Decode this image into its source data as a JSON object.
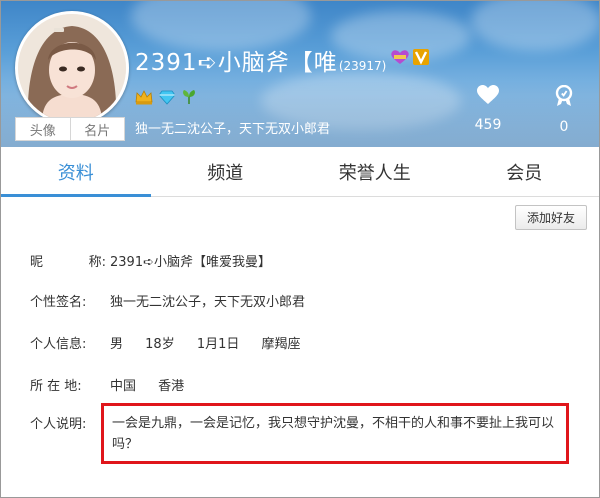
{
  "profile": {
    "nickname": "2391➪小脑斧【唯",
    "user_number": "(23917)",
    "signature": "独一无二沈公子，天下无双小郎君",
    "avatar_tabs": [
      "头像",
      "名片"
    ],
    "stats": {
      "likes": "459",
      "honors": "0"
    }
  },
  "tabs": [
    "资料",
    "频道",
    "荣誉人生",
    "会员"
  ],
  "actions": {
    "add_friend": "添加好友"
  },
  "details": {
    "nickname": {
      "label_chars": [
        "昵",
        "称:"
      ],
      "value": "2391➪小脑斧【唯爱我曼】"
    },
    "signature": {
      "label": "个性签名:",
      "value": "独一无二沈公子，天下无双小郎君"
    },
    "info": {
      "label": "个人信息:",
      "values": [
        "男",
        "18岁",
        "1月1日",
        "摩羯座"
      ]
    },
    "location": {
      "label": "所 在 地:",
      "values": [
        "中国",
        "香港"
      ]
    },
    "description": {
      "label": "个人说明:",
      "value": "一会是九鼎，一会是记忆，我只想守护沈曼，不相干的人和事不要扯上我可以吗？"
    }
  },
  "icons": {
    "heart": "heart-icon",
    "medal": "medal-icon",
    "crown": "crown-icon",
    "diamond": "diamond-icon",
    "leaf": "leaf-icon"
  },
  "colors": {
    "accent": "#3a8fd6",
    "highlight_border": "#e0161b"
  }
}
